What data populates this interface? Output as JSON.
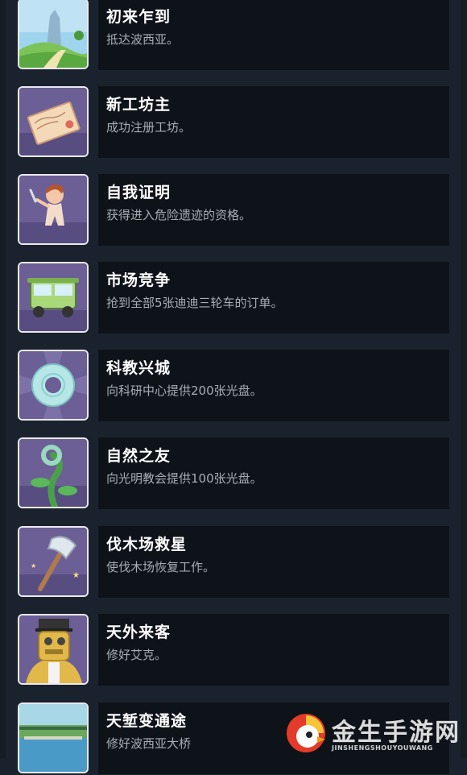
{
  "achievements": [
    {
      "title": "初来乍到",
      "desc": "抵达波西亚。",
      "icon": "landscape-icon"
    },
    {
      "title": "新工坊主",
      "desc": "成功注册工坊。",
      "icon": "certificate-icon"
    },
    {
      "title": "自我证明",
      "desc": "获得进入危险遗迹的资格。",
      "icon": "hero-boy-icon"
    },
    {
      "title": "市场竞争",
      "desc": "抢到全部5张迪迪三轮车的订单。",
      "icon": "tricycle-icon"
    },
    {
      "title": "科教兴城",
      "desc": "向科研中心提供200张光盘。",
      "icon": "disc-icon"
    },
    {
      "title": "自然之友",
      "desc": "向光明教会提供100张光盘。",
      "icon": "vine-icon"
    },
    {
      "title": "伐木场救星",
      "desc": "使伐木场恢复工作。",
      "icon": "axe-icon"
    },
    {
      "title": "天外来客",
      "desc": "修好艾克。",
      "icon": "robot-icon"
    },
    {
      "title": "天堑变通途",
      "desc": "修好波西亚大桥",
      "icon": "bridge-icon"
    }
  ],
  "watermark": {
    "text": "金生手游网",
    "subtext": "JINSHENGSHOUYOUWANG"
  },
  "colors": {
    "background": "#1a232d",
    "panel": "#0e1319",
    "title": "#ffffff",
    "description": "#a7adb4"
  }
}
